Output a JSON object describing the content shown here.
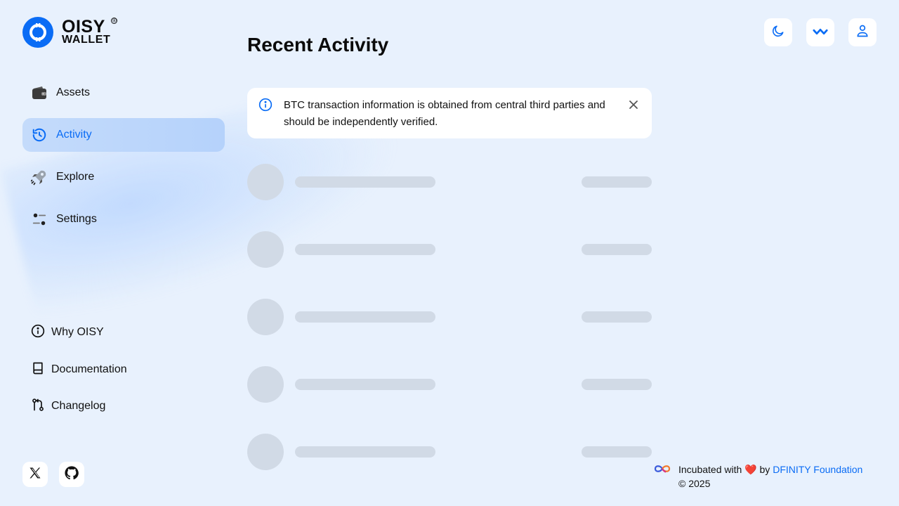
{
  "brand": {
    "line1": "OISY",
    "line2": "WALLET",
    "reg": "®"
  },
  "nav": {
    "items": [
      {
        "label": "Assets",
        "icon": "wallet-icon",
        "active": false
      },
      {
        "label": "Activity",
        "icon": "history-icon",
        "active": true
      },
      {
        "label": "Explore",
        "icon": "rocket-icon",
        "active": false
      },
      {
        "label": "Settings",
        "icon": "sliders-icon",
        "active": false
      }
    ]
  },
  "links": {
    "why": "Why OISY",
    "docs": "Documentation",
    "changelog": "Changelog"
  },
  "header": {
    "theme_icon": "moon-icon",
    "wallet_connect_icon": "wallet-connect-icon",
    "profile_icon": "user-icon"
  },
  "main": {
    "title": "Recent Activity",
    "alert": {
      "message": "BTC transaction information is obtained from central third parties and should be independently verified."
    },
    "skeleton_rows": 5
  },
  "footer": {
    "incubated_prefix": "Incubated with",
    "heart": "❤️",
    "by": "by",
    "org_link": "DFINITY Foundation",
    "copyright": "© 2025"
  },
  "colors": {
    "accent": "#0a6cf5",
    "background": "#e8f1fd",
    "skeleton": "#d1dae6",
    "active_nav": "#c4dbfb"
  }
}
